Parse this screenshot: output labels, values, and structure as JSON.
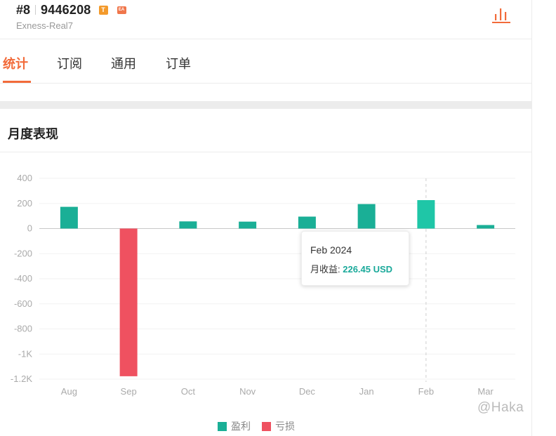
{
  "header": {
    "rank": "#8",
    "account": "9446208",
    "badge_t": "T",
    "badge_ea": "EA",
    "server": "Exness-Real7",
    "chart_icon": "bar-chart-icon"
  },
  "tabs": [
    {
      "label": "统计",
      "active": true
    },
    {
      "label": "订阅",
      "active": false
    },
    {
      "label": "通用",
      "active": false
    },
    {
      "label": "订单",
      "active": false
    }
  ],
  "section": {
    "title": "月度表现"
  },
  "tooltip": {
    "title": "Feb 2024",
    "label": "月收益: ",
    "value": "226.45 USD"
  },
  "legend": {
    "profit": "盈利",
    "loss": "亏损"
  },
  "watermark": "@Haka",
  "colors": {
    "accent": "#f26b3a",
    "profit": "#1aaf96",
    "profit_active": "#1fc6a7",
    "loss": "#ef5160"
  },
  "chart_data": {
    "type": "bar",
    "categories": [
      "Aug",
      "Sep",
      "Oct",
      "Nov",
      "Dec",
      "Jan",
      "Feb",
      "Mar"
    ],
    "values": [
      173,
      -1177,
      57,
      55,
      95,
      195,
      226.45,
      28
    ],
    "y_ticks": [
      400,
      200,
      0,
      -200,
      -400,
      -600,
      -800,
      -1000,
      -1200
    ],
    "y_tick_labels": [
      "400",
      "200",
      "0",
      "-200",
      "-400",
      "-600",
      "-800",
      "-1K",
      "-1.2K"
    ],
    "ylim": [
      -1200,
      400
    ],
    "highlight_category": "Feb",
    "grid": true
  }
}
